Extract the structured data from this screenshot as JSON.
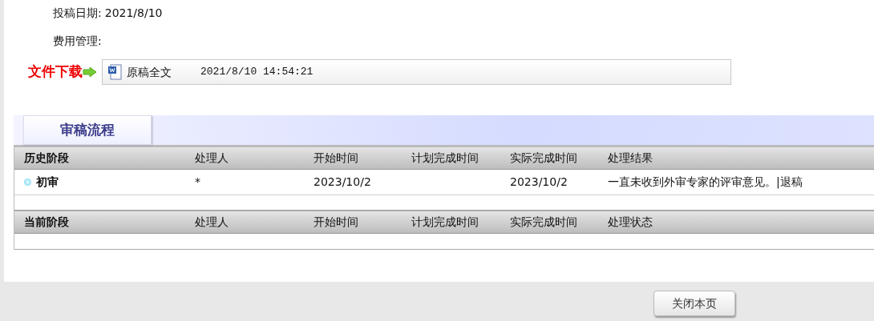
{
  "fields": [
    {
      "label": "投稿日期:",
      "value": "2021/8/10"
    },
    {
      "label": "费用管理:"
    }
  ],
  "download": {
    "label": "文件下载",
    "file": "原稿全文",
    "time": "2021/8/10 14:54:21"
  },
  "tab": {
    "label": "审稿流程",
    "selected": true
  },
  "history": {
    "columns": [
      "历史阶段",
      "处理人",
      "开始时间",
      "计划完成时间",
      "实际完成时间",
      "处理结果"
    ],
    "rows": [
      {
        "cells": [
          "初审",
          "*",
          "2023/10/2",
          "",
          "2023/10/2",
          "一直未收到外审专家的评审意见。|退稿"
        ]
      }
    ]
  },
  "current": {
    "columns": [
      "当前阶段",
      "处理人",
      "开始时间",
      "计划完成时间",
      "实际完成时间",
      "处理状态"
    ]
  },
  "buttons": [
    "关闭本页"
  ]
}
